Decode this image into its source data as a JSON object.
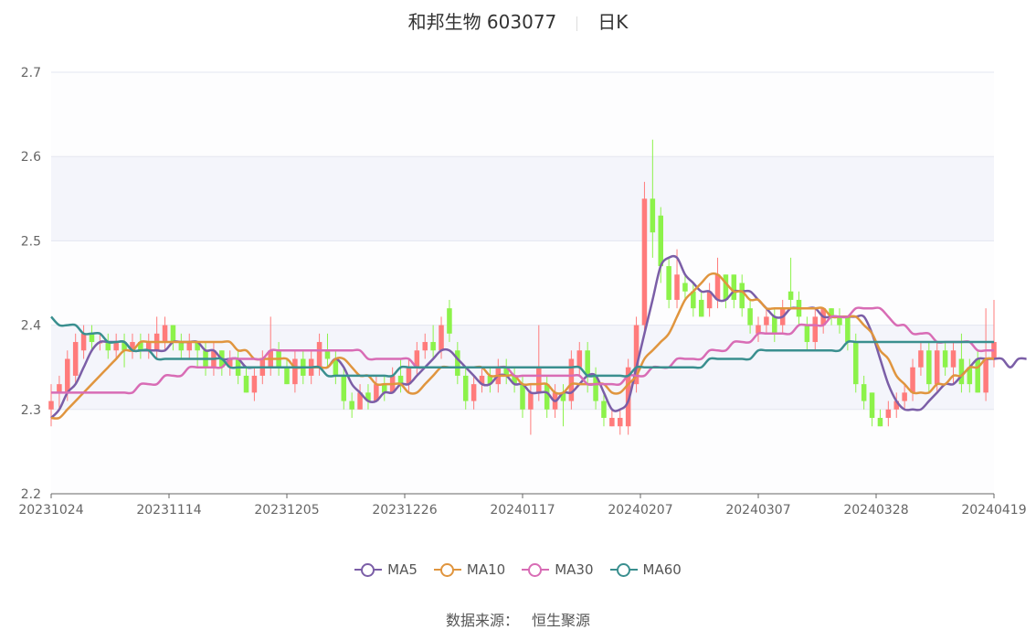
{
  "title": {
    "stock_name": "和邦生物 603077",
    "period": "日K"
  },
  "source": {
    "label": "数据来源：",
    "value": "恒生聚源"
  },
  "colors": {
    "up": "#ff7b7b",
    "down": "#8cf24a",
    "MA5": "#7b5ea7",
    "MA10": "#e0953e",
    "MA30": "#d86cb5",
    "MA60": "#3a8f8f"
  },
  "chart_data": {
    "type": "candlestick",
    "ylim": [
      2.2,
      2.7
    ],
    "yticks": [
      "2.2",
      "2.3",
      "2.4",
      "2.5",
      "2.6",
      "2.7"
    ],
    "x_tick_labels": [
      "20231024",
      "20231114",
      "20231205",
      "20231226",
      "20240117",
      "20240207",
      "20240307",
      "20240328",
      "20240419"
    ],
    "legend": [
      "MA5",
      "MA10",
      "MA30",
      "MA60"
    ],
    "legend_position": "bottom",
    "grid": true,
    "candles": [
      {
        "o": 2.3,
        "c": 2.31,
        "h": 2.33,
        "l": 2.28
      },
      {
        "o": 2.32,
        "c": 2.33,
        "h": 2.34,
        "l": 2.3
      },
      {
        "o": 2.32,
        "c": 2.36,
        "h": 2.37,
        "l": 2.31
      },
      {
        "o": 2.34,
        "c": 2.38,
        "h": 2.39,
        "l": 2.33
      },
      {
        "o": 2.37,
        "c": 2.39,
        "h": 2.4,
        "l": 2.36
      },
      {
        "o": 2.39,
        "c": 2.38,
        "h": 2.4,
        "l": 2.37
      },
      {
        "o": 2.38,
        "c": 2.38,
        "h": 2.39,
        "l": 2.37
      },
      {
        "o": 2.38,
        "c": 2.37,
        "h": 2.39,
        "l": 2.36
      },
      {
        "o": 2.37,
        "c": 2.38,
        "h": 2.39,
        "l": 2.36
      },
      {
        "o": 2.38,
        "c": 2.37,
        "h": 2.39,
        "l": 2.35
      },
      {
        "o": 2.37,
        "c": 2.38,
        "h": 2.39,
        "l": 2.36
      },
      {
        "o": 2.38,
        "c": 2.37,
        "h": 2.39,
        "l": 2.36
      },
      {
        "o": 2.37,
        "c": 2.38,
        "h": 2.39,
        "l": 2.36
      },
      {
        "o": 2.37,
        "c": 2.39,
        "h": 2.41,
        "l": 2.36
      },
      {
        "o": 2.38,
        "c": 2.4,
        "h": 2.41,
        "l": 2.37
      },
      {
        "o": 2.4,
        "c": 2.38,
        "h": 2.4,
        "l": 2.37
      },
      {
        "o": 2.38,
        "c": 2.37,
        "h": 2.39,
        "l": 2.36
      },
      {
        "o": 2.37,
        "c": 2.38,
        "h": 2.39,
        "l": 2.36
      },
      {
        "o": 2.38,
        "c": 2.37,
        "h": 2.38,
        "l": 2.35
      },
      {
        "o": 2.37,
        "c": 2.35,
        "h": 2.38,
        "l": 2.34
      },
      {
        "o": 2.35,
        "c": 2.37,
        "h": 2.38,
        "l": 2.34
      },
      {
        "o": 2.37,
        "c": 2.35,
        "h": 2.37,
        "l": 2.34
      },
      {
        "o": 2.35,
        "c": 2.36,
        "h": 2.37,
        "l": 2.34
      },
      {
        "o": 2.36,
        "c": 2.34,
        "h": 2.37,
        "l": 2.33
      },
      {
        "o": 2.34,
        "c": 2.32,
        "h": 2.35,
        "l": 2.32
      },
      {
        "o": 2.32,
        "c": 2.34,
        "h": 2.35,
        "l": 2.31
      },
      {
        "o": 2.34,
        "c": 2.36,
        "h": 2.37,
        "l": 2.33
      },
      {
        "o": 2.35,
        "c": 2.37,
        "h": 2.41,
        "l": 2.34
      },
      {
        "o": 2.37,
        "c": 2.35,
        "h": 2.38,
        "l": 2.34
      },
      {
        "o": 2.35,
        "c": 2.33,
        "h": 2.36,
        "l": 2.33
      },
      {
        "o": 2.33,
        "c": 2.36,
        "h": 2.37,
        "l": 2.32
      },
      {
        "o": 2.36,
        "c": 2.34,
        "h": 2.37,
        "l": 2.33
      },
      {
        "o": 2.34,
        "c": 2.36,
        "h": 2.37,
        "l": 2.33
      },
      {
        "o": 2.35,
        "c": 2.38,
        "h": 2.39,
        "l": 2.34
      },
      {
        "o": 2.37,
        "c": 2.36,
        "h": 2.39,
        "l": 2.35
      },
      {
        "o": 2.36,
        "c": 2.34,
        "h": 2.37,
        "l": 2.33
      },
      {
        "o": 2.34,
        "c": 2.31,
        "h": 2.35,
        "l": 2.3
      },
      {
        "o": 2.31,
        "c": 2.3,
        "h": 2.32,
        "l": 2.29
      },
      {
        "o": 2.3,
        "c": 2.32,
        "h": 2.33,
        "l": 2.3
      },
      {
        "o": 2.32,
        "c": 2.31,
        "h": 2.33,
        "l": 2.3
      },
      {
        "o": 2.31,
        "c": 2.33,
        "h": 2.34,
        "l": 2.31
      },
      {
        "o": 2.33,
        "c": 2.32,
        "h": 2.34,
        "l": 2.31
      },
      {
        "o": 2.32,
        "c": 2.34,
        "h": 2.35,
        "l": 2.32
      },
      {
        "o": 2.34,
        "c": 2.33,
        "h": 2.36,
        "l": 2.32
      },
      {
        "o": 2.33,
        "c": 2.35,
        "h": 2.36,
        "l": 2.32
      },
      {
        "o": 2.35,
        "c": 2.37,
        "h": 2.38,
        "l": 2.34
      },
      {
        "o": 2.37,
        "c": 2.38,
        "h": 2.39,
        "l": 2.36
      },
      {
        "o": 2.38,
        "c": 2.37,
        "h": 2.4,
        "l": 2.36
      },
      {
        "o": 2.37,
        "c": 2.4,
        "h": 2.41,
        "l": 2.36
      },
      {
        "o": 2.42,
        "c": 2.39,
        "h": 2.43,
        "l": 2.38
      },
      {
        "o": 2.37,
        "c": 2.34,
        "h": 2.38,
        "l": 2.33
      },
      {
        "o": 2.34,
        "c": 2.31,
        "h": 2.35,
        "l": 2.3
      },
      {
        "o": 2.31,
        "c": 2.33,
        "h": 2.34,
        "l": 2.3
      },
      {
        "o": 2.33,
        "c": 2.34,
        "h": 2.35,
        "l": 2.32
      },
      {
        "o": 2.34,
        "c": 2.33,
        "h": 2.35,
        "l": 2.32
      },
      {
        "o": 2.33,
        "c": 2.35,
        "h": 2.36,
        "l": 2.32
      },
      {
        "o": 2.35,
        "c": 2.34,
        "h": 2.36,
        "l": 2.33
      },
      {
        "o": 2.34,
        "c": 2.33,
        "h": 2.35,
        "l": 2.32
      },
      {
        "o": 2.33,
        "c": 2.3,
        "h": 2.34,
        "l": 2.29
      },
      {
        "o": 2.3,
        "c": 2.32,
        "h": 2.33,
        "l": 2.27
      },
      {
        "o": 2.32,
        "c": 2.35,
        "h": 2.4,
        "l": 2.31
      },
      {
        "o": 2.33,
        "c": 2.3,
        "h": 2.34,
        "l": 2.29
      },
      {
        "o": 2.3,
        "c": 2.32,
        "h": 2.33,
        "l": 2.29
      },
      {
        "o": 2.32,
        "c": 2.31,
        "h": 2.33,
        "l": 2.28
      },
      {
        "o": 2.31,
        "c": 2.36,
        "h": 2.37,
        "l": 2.3
      },
      {
        "o": 2.35,
        "c": 2.37,
        "h": 2.38,
        "l": 2.34
      },
      {
        "o": 2.37,
        "c": 2.34,
        "h": 2.38,
        "l": 2.32
      },
      {
        "o": 2.34,
        "c": 2.31,
        "h": 2.35,
        "l": 2.3
      },
      {
        "o": 2.31,
        "c": 2.29,
        "h": 2.32,
        "l": 2.28
      },
      {
        "o": 2.28,
        "c": 2.29,
        "h": 2.3,
        "l": 2.28
      },
      {
        "o": 2.28,
        "c": 2.29,
        "h": 2.3,
        "l": 2.27
      },
      {
        "o": 2.28,
        "c": 2.35,
        "h": 2.36,
        "l": 2.27
      },
      {
        "o": 2.33,
        "c": 2.4,
        "h": 2.41,
        "l": 2.32
      },
      {
        "o": 2.4,
        "c": 2.55,
        "h": 2.57,
        "l": 2.39
      },
      {
        "o": 2.55,
        "c": 2.51,
        "h": 2.62,
        "l": 2.48
      },
      {
        "o": 2.53,
        "c": 2.47,
        "h": 2.54,
        "l": 2.45
      },
      {
        "o": 2.47,
        "c": 2.43,
        "h": 2.48,
        "l": 2.42
      },
      {
        "o": 2.43,
        "c": 2.46,
        "h": 2.49,
        "l": 2.42
      },
      {
        "o": 2.45,
        "c": 2.44,
        "h": 2.46,
        "l": 2.43
      },
      {
        "o": 2.44,
        "c": 2.42,
        "h": 2.45,
        "l": 2.41
      },
      {
        "o": 2.43,
        "c": 2.41,
        "h": 2.44,
        "l": 2.41
      },
      {
        "o": 2.42,
        "c": 2.44,
        "h": 2.45,
        "l": 2.41
      },
      {
        "o": 2.43,
        "c": 2.46,
        "h": 2.48,
        "l": 2.42
      },
      {
        "o": 2.46,
        "c": 2.43,
        "h": 2.46,
        "l": 2.42
      },
      {
        "o": 2.46,
        "c": 2.43,
        "h": 2.46,
        "l": 2.42
      },
      {
        "o": 2.45,
        "c": 2.42,
        "h": 2.46,
        "l": 2.41
      },
      {
        "o": 2.42,
        "c": 2.4,
        "h": 2.43,
        "l": 2.39
      },
      {
        "o": 2.39,
        "c": 2.4,
        "h": 2.41,
        "l": 2.38
      },
      {
        "o": 2.4,
        "c": 2.41,
        "h": 2.42,
        "l": 2.39
      },
      {
        "o": 2.41,
        "c": 2.39,
        "h": 2.42,
        "l": 2.38
      },
      {
        "o": 2.4,
        "c": 2.42,
        "h": 2.43,
        "l": 2.39
      },
      {
        "o": 2.44,
        "c": 2.43,
        "h": 2.48,
        "l": 2.42
      },
      {
        "o": 2.43,
        "c": 2.41,
        "h": 2.44,
        "l": 2.4
      },
      {
        "o": 2.4,
        "c": 2.38,
        "h": 2.41,
        "l": 2.37
      },
      {
        "o": 2.38,
        "c": 2.41,
        "h": 2.42,
        "l": 2.37
      },
      {
        "o": 2.4,
        "c": 2.42,
        "h": 2.42,
        "l": 2.39
      },
      {
        "o": 2.42,
        "c": 2.41,
        "h": 2.42,
        "l": 2.4
      },
      {
        "o": 2.41,
        "c": 2.4,
        "h": 2.42,
        "l": 2.39
      },
      {
        "o": 2.41,
        "c": 2.38,
        "h": 2.41,
        "l": 2.37
      },
      {
        "o": 2.38,
        "c": 2.33,
        "h": 2.39,
        "l": 2.32
      },
      {
        "o": 2.33,
        "c": 2.31,
        "h": 2.34,
        "l": 2.3
      },
      {
        "o": 2.32,
        "c": 2.29,
        "h": 2.32,
        "l": 2.28
      },
      {
        "o": 2.29,
        "c": 2.28,
        "h": 2.3,
        "l": 2.28
      },
      {
        "o": 2.29,
        "c": 2.3,
        "h": 2.31,
        "l": 2.28
      },
      {
        "o": 2.3,
        "c": 2.31,
        "h": 2.32,
        "l": 2.29
      },
      {
        "o": 2.31,
        "c": 2.32,
        "h": 2.33,
        "l": 2.3
      },
      {
        "o": 2.32,
        "c": 2.35,
        "h": 2.36,
        "l": 2.31
      },
      {
        "o": 2.35,
        "c": 2.37,
        "h": 2.38,
        "l": 2.34
      },
      {
        "o": 2.37,
        "c": 2.33,
        "h": 2.38,
        "l": 2.32
      },
      {
        "o": 2.33,
        "c": 2.37,
        "h": 2.38,
        "l": 2.32
      },
      {
        "o": 2.37,
        "c": 2.35,
        "h": 2.38,
        "l": 2.34
      },
      {
        "o": 2.35,
        "c": 2.37,
        "h": 2.38,
        "l": 2.33
      },
      {
        "o": 2.36,
        "c": 2.33,
        "h": 2.39,
        "l": 2.32
      },
      {
        "o": 2.35,
        "c": 2.33,
        "h": 2.36,
        "l": 2.32
      },
      {
        "o": 2.36,
        "c": 2.32,
        "h": 2.37,
        "l": 2.32
      },
      {
        "o": 2.32,
        "c": 2.36,
        "h": 2.42,
        "l": 2.31
      },
      {
        "o": 2.36,
        "c": 2.38,
        "h": 2.43,
        "l": 2.35
      }
    ],
    "series": [
      {
        "name": "MA5",
        "values": [
          2.29,
          2.3,
          2.32,
          2.33,
          2.35,
          2.37,
          2.38,
          2.38,
          2.38,
          2.38,
          2.37,
          2.37,
          2.37,
          2.37,
          2.37,
          2.38,
          2.38,
          2.38,
          2.38,
          2.37,
          2.37,
          2.36,
          2.36,
          2.36,
          2.35,
          2.35,
          2.35,
          2.35,
          2.35,
          2.35,
          2.35,
          2.35,
          2.35,
          2.35,
          2.35,
          2.36,
          2.35,
          2.33,
          2.32,
          2.31,
          2.31,
          2.32,
          2.32,
          2.33,
          2.33,
          2.34,
          2.35,
          2.36,
          2.37,
          2.37,
          2.36,
          2.35,
          2.34,
          2.33,
          2.33,
          2.34,
          2.34,
          2.33,
          2.33,
          2.32,
          2.32,
          2.32,
          2.31,
          2.32,
          2.32,
          2.33,
          2.34,
          2.34,
          2.32,
          2.3,
          2.3,
          2.31,
          2.35,
          2.39,
          2.43,
          2.47,
          2.48,
          2.48,
          2.46,
          2.45,
          2.44,
          2.44,
          2.43,
          2.43,
          2.44,
          2.44,
          2.44,
          2.43,
          2.42,
          2.41,
          2.41,
          2.42,
          2.42,
          2.42,
          2.42,
          2.41,
          2.41,
          2.41,
          2.41,
          2.41,
          2.41,
          2.39,
          2.36,
          2.33,
          2.31,
          2.3,
          2.3,
          2.3,
          2.31,
          2.32,
          2.33,
          2.33,
          2.34,
          2.35,
          2.36,
          2.36,
          2.36,
          2.36,
          2.35,
          2.36,
          2.36
        ]
      },
      {
        "name": "MA10",
        "values": [
          2.29,
          2.29,
          2.3,
          2.31,
          2.32,
          2.33,
          2.34,
          2.35,
          2.36,
          2.37,
          2.37,
          2.38,
          2.38,
          2.38,
          2.38,
          2.38,
          2.38,
          2.38,
          2.38,
          2.38,
          2.38,
          2.38,
          2.38,
          2.37,
          2.37,
          2.36,
          2.36,
          2.36,
          2.36,
          2.36,
          2.35,
          2.35,
          2.35,
          2.35,
          2.35,
          2.36,
          2.36,
          2.35,
          2.34,
          2.34,
          2.33,
          2.33,
          2.33,
          2.33,
          2.32,
          2.32,
          2.33,
          2.34,
          2.35,
          2.35,
          2.35,
          2.35,
          2.35,
          2.35,
          2.34,
          2.34,
          2.34,
          2.34,
          2.33,
          2.33,
          2.33,
          2.33,
          2.32,
          2.32,
          2.33,
          2.33,
          2.33,
          2.33,
          2.33,
          2.32,
          2.32,
          2.33,
          2.34,
          2.36,
          2.37,
          2.38,
          2.39,
          2.41,
          2.43,
          2.44,
          2.45,
          2.46,
          2.46,
          2.45,
          2.44,
          2.44,
          2.43,
          2.43,
          2.42,
          2.42,
          2.42,
          2.42,
          2.42,
          2.42,
          2.42,
          2.42,
          2.41,
          2.41,
          2.41,
          2.41,
          2.4,
          2.39,
          2.37,
          2.36,
          2.34,
          2.33,
          2.32,
          2.32,
          2.32,
          2.33,
          2.33,
          2.34,
          2.34,
          2.35,
          2.35,
          2.36,
          2.36
        ]
      },
      {
        "name": "MA30",
        "values": [
          2.32,
          2.32,
          2.32,
          2.32,
          2.32,
          2.32,
          2.32,
          2.32,
          2.32,
          2.32,
          2.32,
          2.33,
          2.33,
          2.33,
          2.34,
          2.34,
          2.34,
          2.35,
          2.35,
          2.35,
          2.35,
          2.35,
          2.36,
          2.36,
          2.36,
          2.36,
          2.36,
          2.37,
          2.37,
          2.37,
          2.37,
          2.37,
          2.37,
          2.37,
          2.37,
          2.37,
          2.37,
          2.37,
          2.37,
          2.36,
          2.36,
          2.36,
          2.36,
          2.36,
          2.36,
          2.35,
          2.35,
          2.35,
          2.35,
          2.35,
          2.35,
          2.35,
          2.35,
          2.35,
          2.35,
          2.35,
          2.35,
          2.34,
          2.34,
          2.34,
          2.34,
          2.34,
          2.34,
          2.34,
          2.34,
          2.34,
          2.33,
          2.33,
          2.33,
          2.33,
          2.33,
          2.34,
          2.34,
          2.34,
          2.35,
          2.35,
          2.35,
          2.36,
          2.36,
          2.36,
          2.36,
          2.37,
          2.37,
          2.37,
          2.38,
          2.38,
          2.38,
          2.39,
          2.39,
          2.39,
          2.39,
          2.39,
          2.4,
          2.4,
          2.4,
          2.4,
          2.41,
          2.41,
          2.41,
          2.42,
          2.42,
          2.42,
          2.42,
          2.41,
          2.4,
          2.4,
          2.39,
          2.39,
          2.39,
          2.38,
          2.38,
          2.38,
          2.38,
          2.38,
          2.37,
          2.37,
          2.37
        ]
      },
      {
        "name": "MA60",
        "values": [
          2.41,
          2.4,
          2.4,
          2.4,
          2.39,
          2.39,
          2.39,
          2.38,
          2.38,
          2.38,
          2.37,
          2.37,
          2.37,
          2.36,
          2.36,
          2.36,
          2.36,
          2.36,
          2.36,
          2.36,
          2.36,
          2.36,
          2.35,
          2.35,
          2.35,
          2.35,
          2.35,
          2.35,
          2.35,
          2.35,
          2.35,
          2.35,
          2.35,
          2.35,
          2.34,
          2.34,
          2.34,
          2.34,
          2.34,
          2.34,
          2.34,
          2.34,
          2.34,
          2.35,
          2.35,
          2.35,
          2.35,
          2.35,
          2.35,
          2.35,
          2.35,
          2.35,
          2.35,
          2.35,
          2.35,
          2.35,
          2.35,
          2.35,
          2.35,
          2.35,
          2.35,
          2.35,
          2.35,
          2.35,
          2.35,
          2.35,
          2.34,
          2.34,
          2.34,
          2.34,
          2.34,
          2.34,
          2.35,
          2.35,
          2.35,
          2.35,
          2.35,
          2.35,
          2.35,
          2.35,
          2.35,
          2.36,
          2.36,
          2.36,
          2.36,
          2.36,
          2.36,
          2.37,
          2.37,
          2.37,
          2.37,
          2.37,
          2.37,
          2.37,
          2.37,
          2.37,
          2.37,
          2.37,
          2.38,
          2.38,
          2.38,
          2.38,
          2.38,
          2.38,
          2.38,
          2.38,
          2.38,
          2.38,
          2.38,
          2.38,
          2.38,
          2.38,
          2.38,
          2.38,
          2.38,
          2.38,
          2.38
        ]
      }
    ]
  }
}
